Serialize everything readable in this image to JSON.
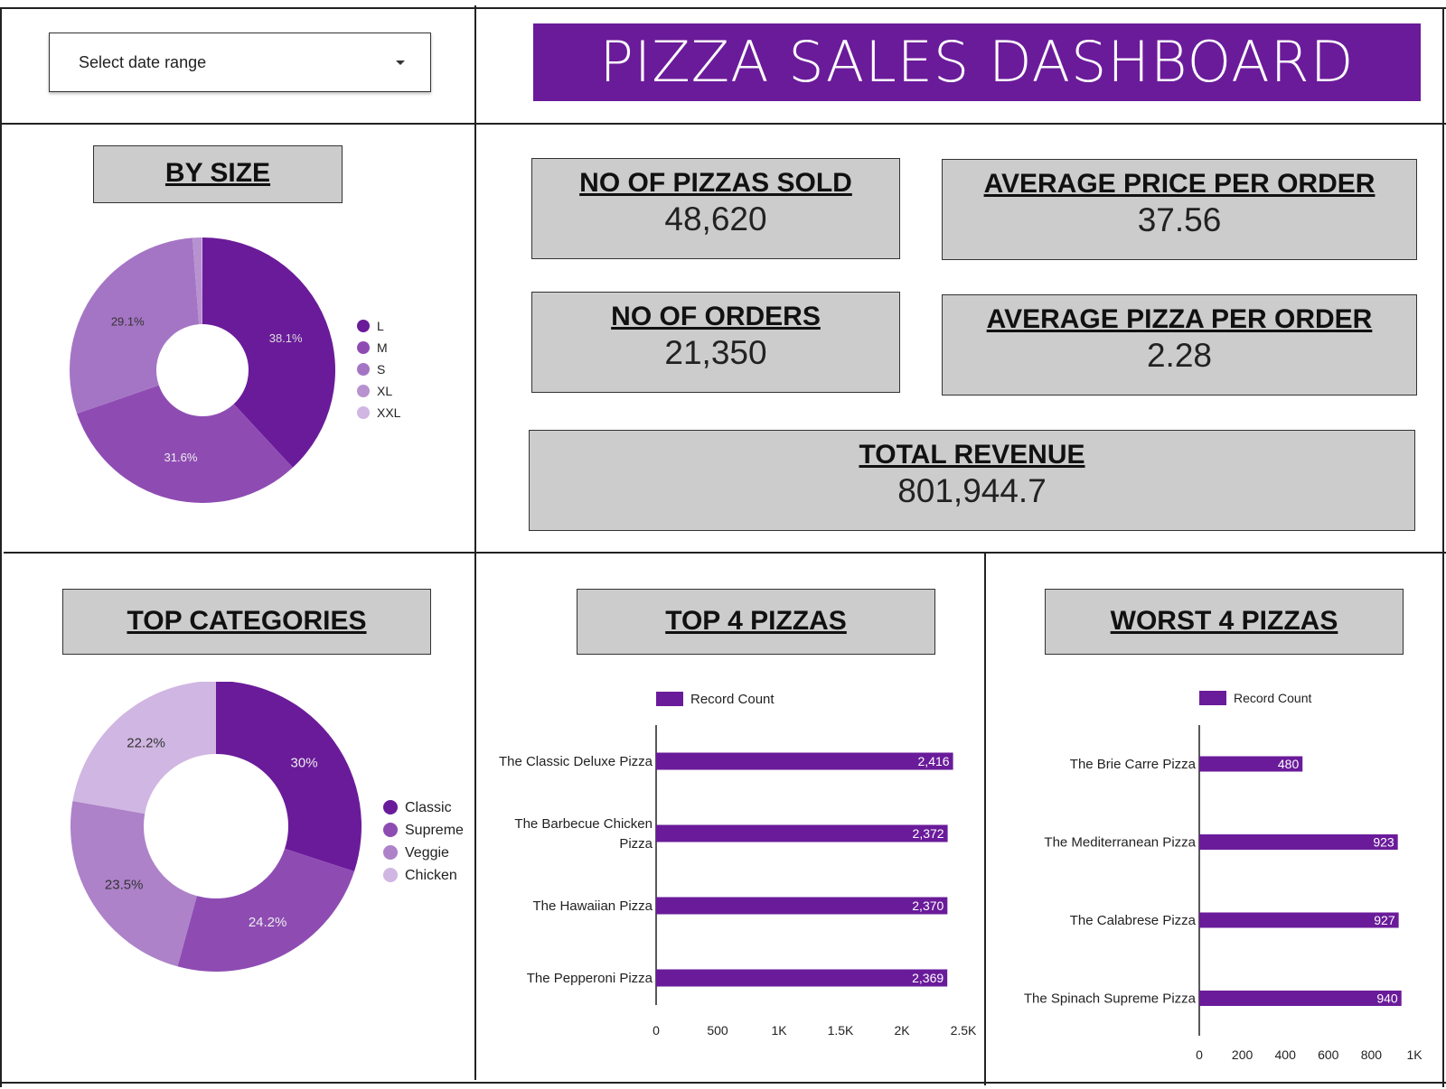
{
  "header": {
    "date_range_placeholder": "Select date range",
    "dashboard_title": "PIZZA SALES DASHBOARD"
  },
  "kpis": {
    "pizzas_sold": {
      "label": "NO OF PIZZAS SOLD",
      "value": "48,620"
    },
    "avg_price": {
      "label": "AVERAGE PRICE PER ORDER",
      "value": "37.56"
    },
    "orders": {
      "label": "NO OF ORDERS",
      "value": "21,350"
    },
    "avg_pizza": {
      "label": "AVERAGE PIZZA PER ORDER",
      "value": "2.28"
    },
    "revenue": {
      "label": "TOTAL REVENUE",
      "value": "801,944.7"
    }
  },
  "sections": {
    "by_size": "BY SIZE",
    "top_categories": "TOP CATEGORIES",
    "top4": "TOP 4 PIZZAS",
    "worst4": "WORST 4 PIZZAS"
  },
  "colors": {
    "accent": "#6a1b9a",
    "panel": "#cccccc"
  },
  "chart_data": [
    {
      "type": "pie",
      "title": "BY SIZE",
      "donut": true,
      "labels": [
        "L",
        "M",
        "S",
        "XL",
        "XXL"
      ],
      "values": [
        38.1,
        31.6,
        29.1,
        1.1,
        0.1
      ],
      "value_labels": [
        "38.1%",
        "31.6%",
        "29.1%",
        "",
        ""
      ],
      "colors": [
        "#6a1b9a",
        "#8e4cb3",
        "#a575c5",
        "#b891d1",
        "#d0b6e2"
      ],
      "legend": "right"
    },
    {
      "type": "pie",
      "title": "TOP CATEGORIES",
      "donut": true,
      "labels": [
        "Classic",
        "Supreme",
        "Veggie",
        "Chicken"
      ],
      "values": [
        30,
        24.2,
        23.5,
        22.2
      ],
      "value_labels": [
        "30%",
        "24.2%",
        "23.5%",
        "22.2%"
      ],
      "colors": [
        "#6a1b9a",
        "#8e4cb3",
        "#ad82c9",
        "#d0b6e2"
      ],
      "legend": "right"
    },
    {
      "type": "bar",
      "orientation": "horizontal",
      "title": "TOP 4 PIZZAS",
      "series": [
        {
          "name": "Record Count",
          "values": [
            2416,
            2372,
            2370,
            2369
          ]
        }
      ],
      "categories": [
        [
          "The Classic Deluxe Pizza"
        ],
        [
          "The Barbecue Chicken",
          "Pizza"
        ],
        [
          "The Hawaiian Pizza"
        ],
        [
          "The Pepperoni Pizza"
        ]
      ],
      "value_labels": [
        "2,416",
        "2,372",
        "2,370",
        "2,369"
      ],
      "xlim": [
        0,
        2500
      ],
      "ticks": [
        0,
        500,
        1000,
        1500,
        2000,
        2500
      ],
      "tick_labels": [
        "0",
        "500",
        "1K",
        "1.5K",
        "2K",
        "2.5K"
      ],
      "legend": "top"
    },
    {
      "type": "bar",
      "orientation": "horizontal",
      "title": "WORST 4 PIZZAS",
      "series": [
        {
          "name": "Record Count",
          "values": [
            480,
            923,
            927,
            940
          ]
        }
      ],
      "categories": [
        [
          "The Brie Carre Pizza"
        ],
        [
          "The Mediterranean Pizza"
        ],
        [
          "The Calabrese Pizza"
        ],
        [
          "The Spinach Supreme Pizza"
        ]
      ],
      "value_labels": [
        "480",
        "923",
        "927",
        "940"
      ],
      "xlim": [
        0,
        1000
      ],
      "ticks": [
        0,
        200,
        400,
        600,
        800,
        1000
      ],
      "tick_labels": [
        "0",
        "200",
        "400",
        "600",
        "800",
        "1K"
      ],
      "legend": "top"
    }
  ]
}
